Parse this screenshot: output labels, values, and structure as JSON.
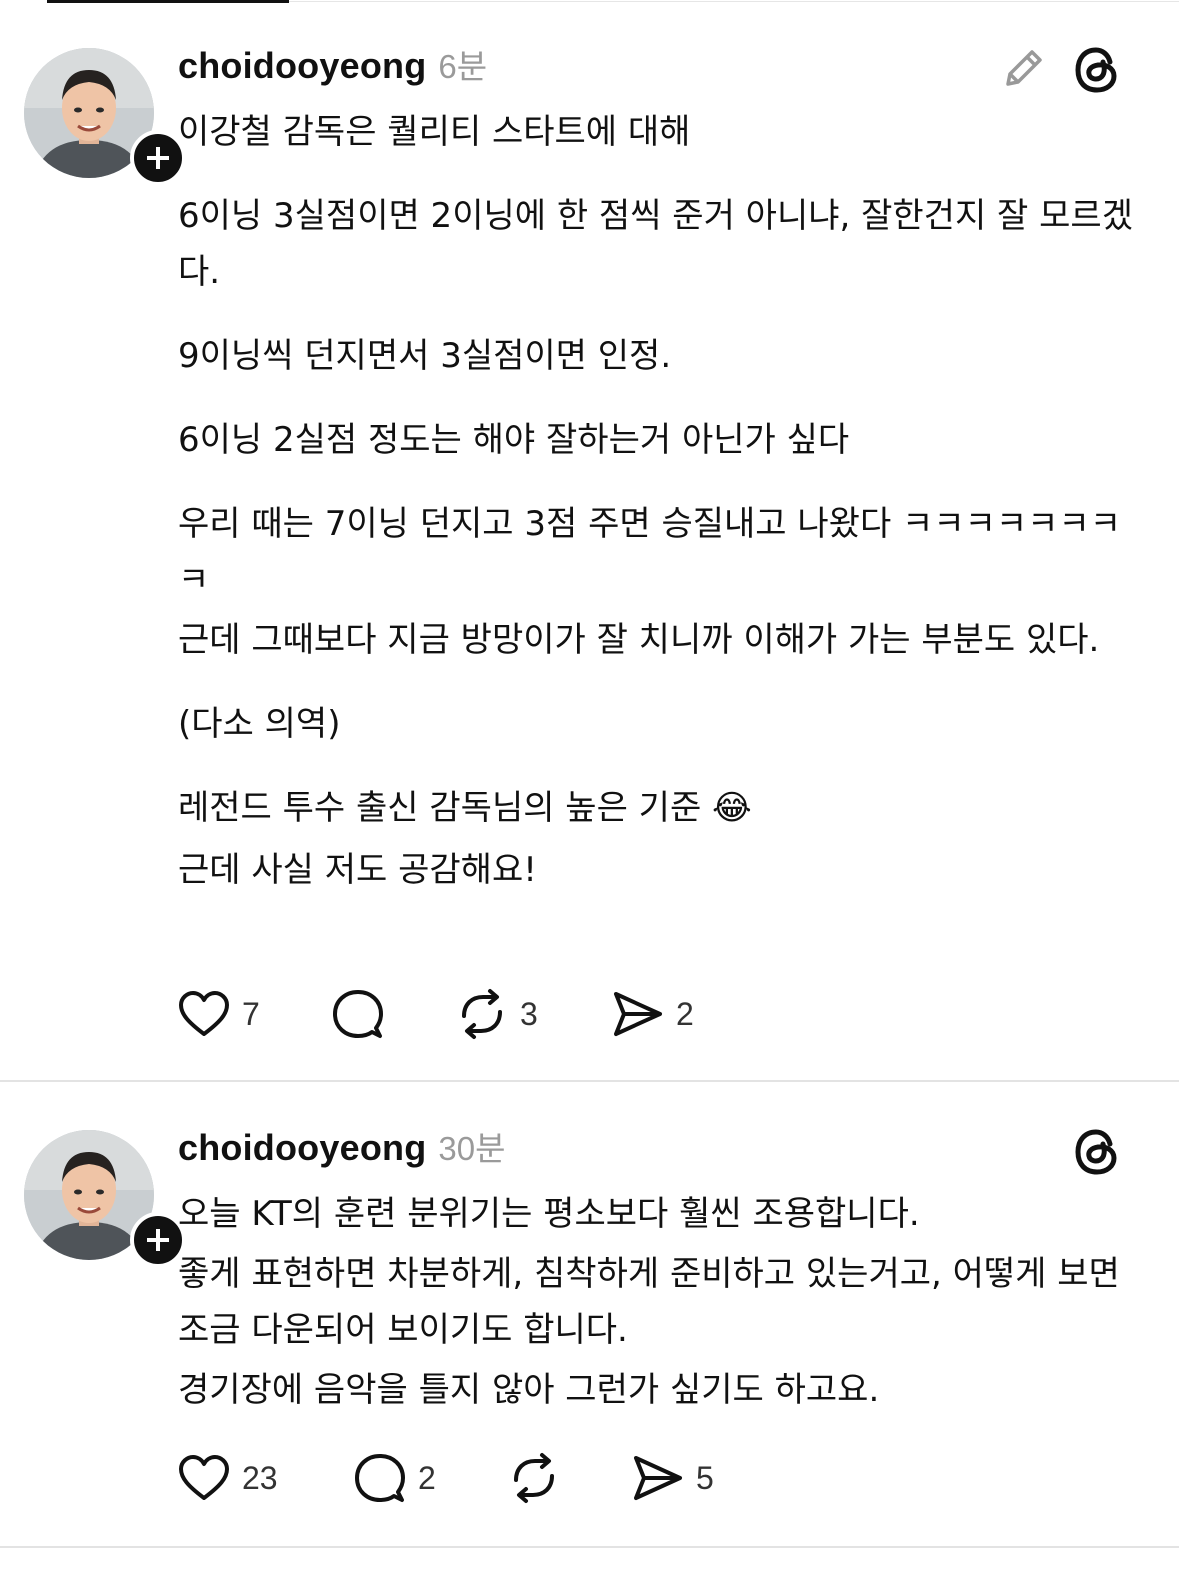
{
  "posts": [
    {
      "username": "choidooyeong",
      "time": "6분",
      "paragraphs": [
        "이강철 감독은 퀄리티 스타트에 대해",
        "6이닝 3실점이면 2이닝에 한 점씩 준거 아니냐, 잘한건지 잘 모르겠다.",
        "9이닝씩 던지면서 3실점이면 인정.",
        "6이닝 2실점 정도는 해야 잘하는거 아닌가 싶다",
        "우리 때는 7이닝 던지고 3점 주면 승질내고 나왔다 ㅋㅋㅋㅋㅋㅋㅋㅋ",
        "근데 그때보다 지금 방망이가 잘 치니까 이해가 가는 부분도 있다.",
        "(다소 의역)",
        "레전드 투수 출신 감독님의 높은 기준 😂",
        "근데 사실 저도 공감해요!"
      ],
      "likes": "7",
      "replies": "",
      "reposts": "3",
      "shares": "2"
    },
    {
      "username": "choidooyeong",
      "time": "30분",
      "paragraphs": [
        "오늘 KT의 훈련 분위기는 평소보다 훨씬 조용합니다.",
        "좋게 표현하면 차분하게, 침착하게 준비하고 있는거고, 어떻게 보면 조금 다운되어 보이기도 합니다.",
        "경기장에 음악을 틀지 않아 그런가 싶기도 하고요."
      ],
      "likes": "23",
      "replies": "2",
      "reposts": "",
      "shares": "5"
    }
  ],
  "icons": {
    "heart": "heart-icon",
    "reply": "reply-icon",
    "repost": "repost-icon",
    "share": "share-icon",
    "edit": "pencil-icon",
    "threads": "threads-logo-icon",
    "follow": "plus-icon"
  },
  "colors": {
    "text": "#111111",
    "muted": "#9a9a9a",
    "divider": "#e3e3e3"
  }
}
